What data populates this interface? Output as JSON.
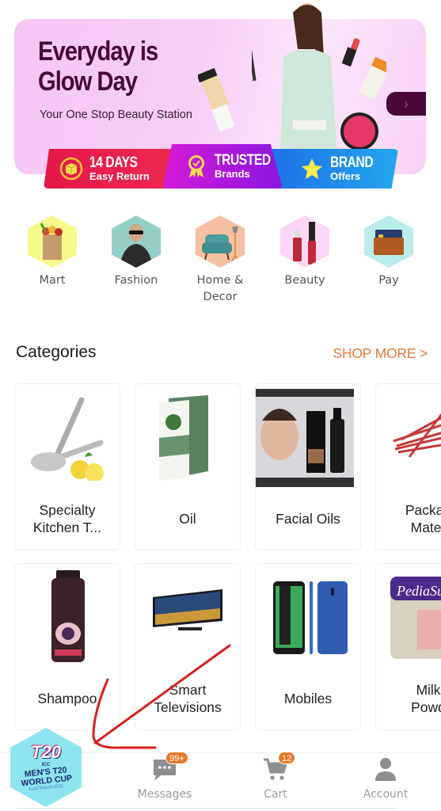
{
  "banner": {
    "title_line1": "Everyday is",
    "title_line2": "Glow Day",
    "subtitle": "Your One Stop Beauty Station",
    "next_icon": "chevron-right-icon",
    "colors": {
      "background": "#f5c6f3",
      "title": "#4a0838",
      "next_button": "#4a0838"
    },
    "badges": [
      {
        "main": "14 DAYS",
        "sub": "Easy Return",
        "icon": "box-return-icon",
        "color": "#e3174a"
      },
      {
        "main": "TRUSTED",
        "sub": "Brands",
        "icon": "award-ribbon-icon",
        "color": "#c01ad9"
      },
      {
        "main": "BRAND",
        "sub": "Offers",
        "icon": "star-icon",
        "color": "#1f8ae9"
      }
    ]
  },
  "quick_nav": [
    {
      "label": "Mart",
      "icon": "grocery-bag-icon",
      "bg": "#f4f98a"
    },
    {
      "label": "Fashion",
      "icon": "fashion-model-icon",
      "bg": "#95cec7"
    },
    {
      "label": "Home &\nDecor",
      "icon": "armchair-icon",
      "bg": "#f7c0a0"
    },
    {
      "label": "Beauty",
      "icon": "lipstick-icon",
      "bg": "#fcd6f6"
    },
    {
      "label": "Pay",
      "icon": "wallet-card-icon",
      "bg": "#b9ecea"
    }
  ],
  "categories": {
    "title": "Categories",
    "shop_more": "SHOP MORE >",
    "accent": "#e07a3a",
    "items": [
      {
        "label": "Specialty\nKitchen T...",
        "image": "lemon-squeezer"
      },
      {
        "label": "Oil",
        "image": "nettle-oil-box"
      },
      {
        "label": "Facial Oils",
        "image": "beard-oil-man"
      },
      {
        "label": "Packag\nMater",
        "image": "red-twist-ties"
      },
      {
        "label": "Shampoo",
        "image": "shampoo-bottle"
      },
      {
        "label": "Smart\nTelevisions",
        "image": "smart-tv"
      },
      {
        "label": "Mobiles",
        "image": "smartphones"
      },
      {
        "label": "Milk\nPowd",
        "image": "milk-powder-can"
      }
    ]
  },
  "bottom_nav": {
    "promo": {
      "line1": "ICC",
      "line2": "MEN'S T20\nWORLD CUP",
      "line3": "AUSTRALIA 2022",
      "logo": "T20"
    },
    "items": [
      {
        "label": "Messages",
        "icon": "chat-bubble-icon",
        "badge": "99+"
      },
      {
        "label": "Cart",
        "icon": "cart-icon",
        "badge": "12"
      },
      {
        "label": "Account",
        "icon": "person-icon"
      }
    ],
    "badge_color": "#e8792b"
  }
}
